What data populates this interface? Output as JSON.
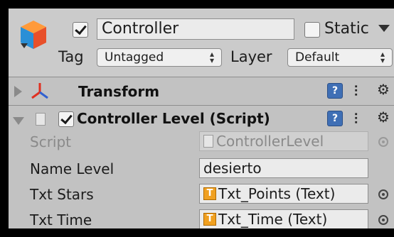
{
  "header": {
    "name": "Controller",
    "active": true,
    "static_label": "Static",
    "static_checked": false,
    "tag_label": "Tag",
    "tag_value": "Untagged",
    "layer_label": "Layer",
    "layer_value": "Default"
  },
  "components": [
    {
      "title": "Transform",
      "icon": "transform-axes-icon",
      "expanded": false
    },
    {
      "title": "Controller Level (Script)",
      "icon": "csharp-script-icon",
      "expanded": true,
      "enabled": true
    }
  ],
  "properties": [
    {
      "label": "Script",
      "value": "ControllerLevel",
      "disabled": true,
      "icon": "csharp-script-icon"
    },
    {
      "label": "Name Level",
      "value": "desierto"
    },
    {
      "label": "Txt Stars",
      "value": "Txt_Points (Text)",
      "icon": "text-component-icon"
    },
    {
      "label": "Txt Time",
      "value": "Txt_Time (Text)",
      "icon": "text-component-icon"
    }
  ],
  "icons": {
    "text_glyph": "T"
  },
  "colors": {
    "panel_bg": "#c2c2c2",
    "header_bg": "#cbcbcb",
    "help_blue": "#3f6fb5",
    "text_icon_orange": "#f0a020"
  }
}
